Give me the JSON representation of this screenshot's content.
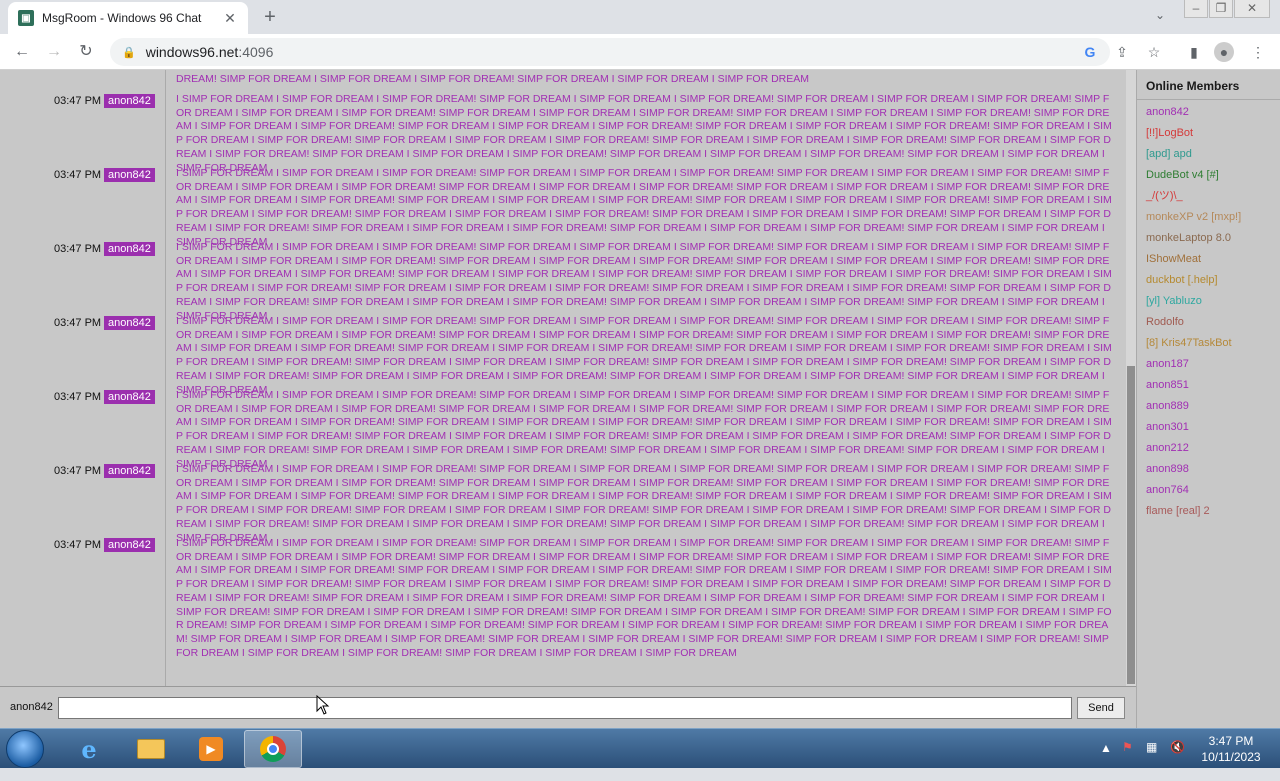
{
  "browser": {
    "tab_title": "MsgRoom - Windows 96 Chat",
    "url_host": "windows96.net",
    "url_port": ":4096"
  },
  "chat": {
    "messages": [
      {
        "time": "",
        "user": "",
        "text": "DREAM! SIMP FOR DREAM I SIMP FOR DREAM I SIMP FOR DREAM! SIMP FOR DREAM I SIMP FOR DREAM I SIMP FOR DREAM"
      },
      {
        "time": "03:47 PM",
        "user": "anon842",
        "text": "I SIMP FOR DREAM I SIMP FOR DREAM I SIMP FOR DREAM! SIMP FOR DREAM I SIMP FOR DREAM I SIMP FOR DREAM! SIMP FOR DREAM I SIMP FOR DREAM I SIMP FOR DREAM! SIMP FOR DREAM I SIMP FOR DREAM I SIMP FOR DREAM! SIMP FOR DREAM I SIMP FOR DREAM I SIMP FOR DREAM! SIMP FOR DREAM I SIMP FOR DREAM I SIMP FOR DREAM! SIMP FOR DREAM I SIMP FOR DREAM I SIMP FOR DREAM! SIMP FOR DREAM I SIMP FOR DREAM I SIMP FOR DREAM! SIMP FOR DREAM I SIMP FOR DREAM I SIMP FOR DREAM! SIMP FOR DREAM I SIMP FOR DREAM I SIMP FOR DREAM! SIMP FOR DREAM I SIMP FOR DREAM I SIMP FOR DREAM! SIMP FOR DREAM I SIMP FOR DREAM I SIMP FOR DREAM! SIMP FOR DREAM I SIMP FOR DREAM I SIMP FOR DREAM! SIMP FOR DREAM I SIMP FOR DREAM I SIMP FOR DREAM! SIMP FOR DREAM I SIMP FOR DREAM I SIMP FOR DREAM! SIMP FOR DREAM I SIMP FOR DREAM I SIMP FOR DREAM"
      },
      {
        "time": "03:47 PM",
        "user": "anon842",
        "text": "I SIMP FOR DREAM I SIMP FOR DREAM I SIMP FOR DREAM! SIMP FOR DREAM I SIMP FOR DREAM I SIMP FOR DREAM! SIMP FOR DREAM I SIMP FOR DREAM I SIMP FOR DREAM! SIMP FOR DREAM I SIMP FOR DREAM I SIMP FOR DREAM! SIMP FOR DREAM I SIMP FOR DREAM I SIMP FOR DREAM! SIMP FOR DREAM I SIMP FOR DREAM I SIMP FOR DREAM! SIMP FOR DREAM I SIMP FOR DREAM I SIMP FOR DREAM! SIMP FOR DREAM I SIMP FOR DREAM I SIMP FOR DREAM! SIMP FOR DREAM I SIMP FOR DREAM I SIMP FOR DREAM! SIMP FOR DREAM I SIMP FOR DREAM I SIMP FOR DREAM! SIMP FOR DREAM I SIMP FOR DREAM I SIMP FOR DREAM! SIMP FOR DREAM I SIMP FOR DREAM I SIMP FOR DREAM! SIMP FOR DREAM I SIMP FOR DREAM I SIMP FOR DREAM! SIMP FOR DREAM I SIMP FOR DREAM I SIMP FOR DREAM! SIMP FOR DREAM I SIMP FOR DREAM I SIMP FOR DREAM! SIMP FOR DREAM I SIMP FOR DREAM I SIMP FOR DREAM"
      },
      {
        "time": "03:47 PM",
        "user": "anon842",
        "text": "I SIMP FOR DREAM I SIMP FOR DREAM I SIMP FOR DREAM! SIMP FOR DREAM I SIMP FOR DREAM I SIMP FOR DREAM! SIMP FOR DREAM I SIMP FOR DREAM I SIMP FOR DREAM! SIMP FOR DREAM I SIMP FOR DREAM I SIMP FOR DREAM! SIMP FOR DREAM I SIMP FOR DREAM I SIMP FOR DREAM! SIMP FOR DREAM I SIMP FOR DREAM I SIMP FOR DREAM! SIMP FOR DREAM I SIMP FOR DREAM I SIMP FOR DREAM! SIMP FOR DREAM I SIMP FOR DREAM I SIMP FOR DREAM! SIMP FOR DREAM I SIMP FOR DREAM I SIMP FOR DREAM! SIMP FOR DREAM I SIMP FOR DREAM I SIMP FOR DREAM! SIMP FOR DREAM I SIMP FOR DREAM I SIMP FOR DREAM! SIMP FOR DREAM I SIMP FOR DREAM I SIMP FOR DREAM! SIMP FOR DREAM I SIMP FOR DREAM I SIMP FOR DREAM! SIMP FOR DREAM I SIMP FOR DREAM I SIMP FOR DREAM! SIMP FOR DREAM I SIMP FOR DREAM I SIMP FOR DREAM! SIMP FOR DREAM I SIMP FOR DREAM I SIMP FOR DREAM"
      },
      {
        "time": "03:47 PM",
        "user": "anon842",
        "text": "I SIMP FOR DREAM I SIMP FOR DREAM I SIMP FOR DREAM! SIMP FOR DREAM I SIMP FOR DREAM I SIMP FOR DREAM! SIMP FOR DREAM I SIMP FOR DREAM I SIMP FOR DREAM! SIMP FOR DREAM I SIMP FOR DREAM I SIMP FOR DREAM! SIMP FOR DREAM I SIMP FOR DREAM I SIMP FOR DREAM! SIMP FOR DREAM I SIMP FOR DREAM I SIMP FOR DREAM! SIMP FOR DREAM I SIMP FOR DREAM I SIMP FOR DREAM! SIMP FOR DREAM I SIMP FOR DREAM I SIMP FOR DREAM! SIMP FOR DREAM I SIMP FOR DREAM I SIMP FOR DREAM! SIMP FOR DREAM I SIMP FOR DREAM I SIMP FOR DREAM! SIMP FOR DREAM I SIMP FOR DREAM I SIMP FOR DREAM! SIMP FOR DREAM I SIMP FOR DREAM I SIMP FOR DREAM! SIMP FOR DREAM I SIMP FOR DREAM I SIMP FOR DREAM! SIMP FOR DREAM I SIMP FOR DREAM I SIMP FOR DREAM! SIMP FOR DREAM I SIMP FOR DREAM I SIMP FOR DREAM! SIMP FOR DREAM I SIMP FOR DREAM I SIMP FOR DREAM"
      },
      {
        "time": "03:47 PM",
        "user": "anon842",
        "text": "I SIMP FOR DREAM I SIMP FOR DREAM I SIMP FOR DREAM! SIMP FOR DREAM I SIMP FOR DREAM I SIMP FOR DREAM! SIMP FOR DREAM I SIMP FOR DREAM I SIMP FOR DREAM! SIMP FOR DREAM I SIMP FOR DREAM I SIMP FOR DREAM! SIMP FOR DREAM I SIMP FOR DREAM I SIMP FOR DREAM! SIMP FOR DREAM I SIMP FOR DREAM I SIMP FOR DREAM! SIMP FOR DREAM I SIMP FOR DREAM I SIMP FOR DREAM! SIMP FOR DREAM I SIMP FOR DREAM I SIMP FOR DREAM! SIMP FOR DREAM I SIMP FOR DREAM I SIMP FOR DREAM! SIMP FOR DREAM I SIMP FOR DREAM I SIMP FOR DREAM! SIMP FOR DREAM I SIMP FOR DREAM I SIMP FOR DREAM! SIMP FOR DREAM I SIMP FOR DREAM I SIMP FOR DREAM! SIMP FOR DREAM I SIMP FOR DREAM I SIMP FOR DREAM! SIMP FOR DREAM I SIMP FOR DREAM I SIMP FOR DREAM! SIMP FOR DREAM I SIMP FOR DREAM I SIMP FOR DREAM! SIMP FOR DREAM I SIMP FOR DREAM I SIMP FOR DREAM"
      },
      {
        "time": "03:47 PM",
        "user": "anon842",
        "text": "I SIMP FOR DREAM I SIMP FOR DREAM I SIMP FOR DREAM! SIMP FOR DREAM I SIMP FOR DREAM I SIMP FOR DREAM! SIMP FOR DREAM I SIMP FOR DREAM I SIMP FOR DREAM! SIMP FOR DREAM I SIMP FOR DREAM I SIMP FOR DREAM! SIMP FOR DREAM I SIMP FOR DREAM I SIMP FOR DREAM! SIMP FOR DREAM I SIMP FOR DREAM I SIMP FOR DREAM! SIMP FOR DREAM I SIMP FOR DREAM I SIMP FOR DREAM! SIMP FOR DREAM I SIMP FOR DREAM I SIMP FOR DREAM! SIMP FOR DREAM I SIMP FOR DREAM I SIMP FOR DREAM! SIMP FOR DREAM I SIMP FOR DREAM I SIMP FOR DREAM! SIMP FOR DREAM I SIMP FOR DREAM I SIMP FOR DREAM! SIMP FOR DREAM I SIMP FOR DREAM I SIMP FOR DREAM! SIMP FOR DREAM I SIMP FOR DREAM I SIMP FOR DREAM! SIMP FOR DREAM I SIMP FOR DREAM I SIMP FOR DREAM! SIMP FOR DREAM I SIMP FOR DREAM I SIMP FOR DREAM! SIMP FOR DREAM I SIMP FOR DREAM I SIMP FOR DREAM"
      },
      {
        "time": "03:47 PM",
        "user": "anon842",
        "text": "I SIMP FOR DREAM I SIMP FOR DREAM I SIMP FOR DREAM! SIMP FOR DREAM I SIMP FOR DREAM I SIMP FOR DREAM! SIMP FOR DREAM I SIMP FOR DREAM I SIMP FOR DREAM! SIMP FOR DREAM I SIMP FOR DREAM I SIMP FOR DREAM! SIMP FOR DREAM I SIMP FOR DREAM I SIMP FOR DREAM! SIMP FOR DREAM I SIMP FOR DREAM I SIMP FOR DREAM! SIMP FOR DREAM I SIMP FOR DREAM I SIMP FOR DREAM! SIMP FOR DREAM I SIMP FOR DREAM I SIMP FOR DREAM! SIMP FOR DREAM I SIMP FOR DREAM I SIMP FOR DREAM! SIMP FOR DREAM I SIMP FOR DREAM I SIMP FOR DREAM! SIMP FOR DREAM I SIMP FOR DREAM I SIMP FOR DREAM! SIMP FOR DREAM I SIMP FOR DREAM I SIMP FOR DREAM! SIMP FOR DREAM I SIMP FOR DREAM I SIMP FOR DREAM! SIMP FOR DREAM I SIMP FOR DREAM I SIMP FOR DREAM! SIMP FOR DREAM I SIMP FOR DREAM I SIMP FOR DREAM! SIMP FOR DREAM I SIMP FOR DREAM I SIMP FOR DREAM! SIMP FOR DREAM I SIMP FOR DREAM I SIMP FOR DREAM! SIMP FOR DREAM I SIMP FOR DREAM I SIMP FOR DREAM! SIMP FOR DREAM I SIMP FOR DREAM I SIMP FOR DREAM! SIMP FOR DREAM I SIMP FOR DREAM I SIMP FOR DREAM! SIMP FOR DREAM I SIMP FOR DREAM I SIMP FOR DREAM! SIMP FOR DREAM I SIMP FOR DREAM I SIMP FOR DREAM! SIMP FOR DREAM I SIMP FOR DREAM I SIMP FOR DREAM! SIMP FOR DREAM I SIMP FOR DREAM I SIMP FOR DREAM! SIMP FOR DREAM I SIMP FOR DREAM I SIMP FOR DREAM! SIMP FOR DREAM I SIMP FOR DREAM I SIMP FOR DREAM! SIMP FOR DREAM I SIMP FOR DREAM I SIMP FOR DREAM"
      }
    ]
  },
  "members": {
    "title": "Online Members",
    "list": [
      {
        "name": "anon842",
        "color": "#a12fb3"
      },
      {
        "name": "[!!]LogBot",
        "color": "#d43a3a"
      },
      {
        "name": "[apd] apd",
        "color": "#2f9a8f"
      },
      {
        "name": "DudeBot v4 [#]",
        "color": "#2e7d32"
      },
      {
        "name": "_/(ツ)\\_",
        "color": "#d43a3a"
      },
      {
        "name": "monkeXP v2 [mxp!]",
        "color": "#b5895a"
      },
      {
        "name": "monkeLaptop 8.0",
        "color": "#8a6a50"
      },
      {
        "name": "IShowMeat",
        "color": "#a0703a"
      },
      {
        "name": "duckbot [.help]",
        "color": "#b58a30"
      },
      {
        "name": "[yl] Yabluzo",
        "color": "#2fa8a0"
      },
      {
        "name": "Rodolfo",
        "color": "#a05a50"
      },
      {
        "name": "[8] Kris47TaskBot",
        "color": "#b5893a"
      },
      {
        "name": "anon187",
        "color": "#a12fb3"
      },
      {
        "name": "anon851",
        "color": "#a12fb3"
      },
      {
        "name": "anon889",
        "color": "#a12fb3"
      },
      {
        "name": "anon301",
        "color": "#a12fb3"
      },
      {
        "name": "anon212",
        "color": "#a12fb3"
      },
      {
        "name": "anon898",
        "color": "#a12fb3"
      },
      {
        "name": "anon764",
        "color": "#a12fb3"
      },
      {
        "name": "flame [real] 2",
        "color": "#a85a5a"
      }
    ]
  },
  "input": {
    "nick": "anon842",
    "value": "",
    "send_label": "Send"
  },
  "taskbar": {
    "time": "3:47 PM",
    "date": "10/11/2023"
  }
}
